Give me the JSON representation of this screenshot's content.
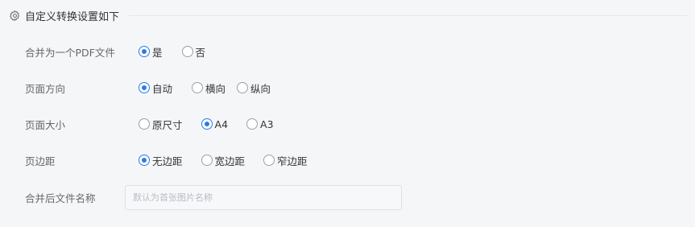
{
  "section": {
    "title": "自定义转换设置如下",
    "icon": "gear-icon"
  },
  "settings": [
    {
      "key": "merge",
      "label": "合并为一个PDF文件",
      "options": [
        {
          "label": "是",
          "checked": true
        },
        {
          "label": "否",
          "checked": false
        }
      ]
    },
    {
      "key": "orientation",
      "label": "页面方向",
      "options": [
        {
          "label": "自动",
          "checked": true
        },
        {
          "label": "横向",
          "checked": false
        },
        {
          "label": "纵向",
          "checked": false
        }
      ]
    },
    {
      "key": "size",
      "label": "页面大小",
      "options": [
        {
          "label": "原尺寸",
          "checked": false
        },
        {
          "label": "A4",
          "checked": true
        },
        {
          "label": "A3",
          "checked": false
        }
      ]
    },
    {
      "key": "margin",
      "label": "页边距",
      "options": [
        {
          "label": "无边距",
          "checked": true
        },
        {
          "label": "宽边距",
          "checked": false
        },
        {
          "label": "窄边距",
          "checked": false
        }
      ]
    }
  ],
  "filename": {
    "label": "合并后文件名称",
    "value": "",
    "placeholder": "默认为首张图片名称"
  },
  "colors": {
    "accent": "#2b7be6",
    "background": "#f5f6f8"
  }
}
